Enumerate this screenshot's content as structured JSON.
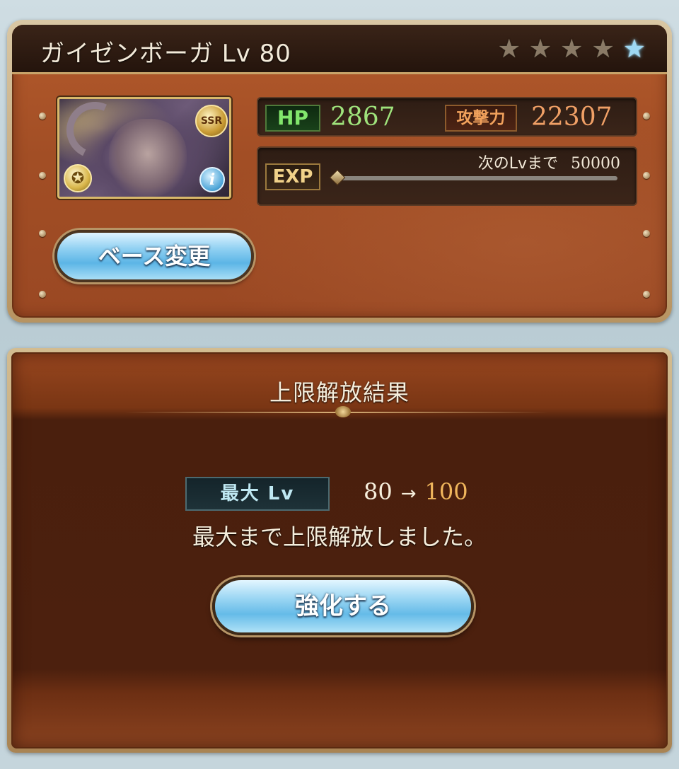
{
  "character": {
    "name": "ガイゼンボーガ Lv 80",
    "rarity_stars": [
      "★",
      "★",
      "★",
      "★",
      "★"
    ],
    "rarity_badge": "SSR",
    "element_icon": "compass-emblem-icon",
    "info_icon_label": "i"
  },
  "stats": {
    "hp_label": "HP",
    "hp_value": "2867",
    "atk_label": "攻撃力",
    "atk_value": "22307",
    "exp_label": "EXP",
    "next_lv_label": "次のLvまで",
    "next_lv_value": "50000",
    "exp_progress": 0
  },
  "buttons": {
    "change_base": "ベース変更",
    "enhance": "強化する"
  },
  "result": {
    "title": "上限解放結果",
    "max_lv_label": "最大 Lv",
    "lv_from": "80",
    "arrow": "→",
    "lv_to": "100",
    "message": "最大まで上限解放しました。"
  },
  "colors": {
    "hp_value": "#9fe37c",
    "atk_value": "#f0a066",
    "lv_to": "#f0b65c",
    "button_blue": "#65bbe8",
    "panel_brown": "#a24e25"
  }
}
